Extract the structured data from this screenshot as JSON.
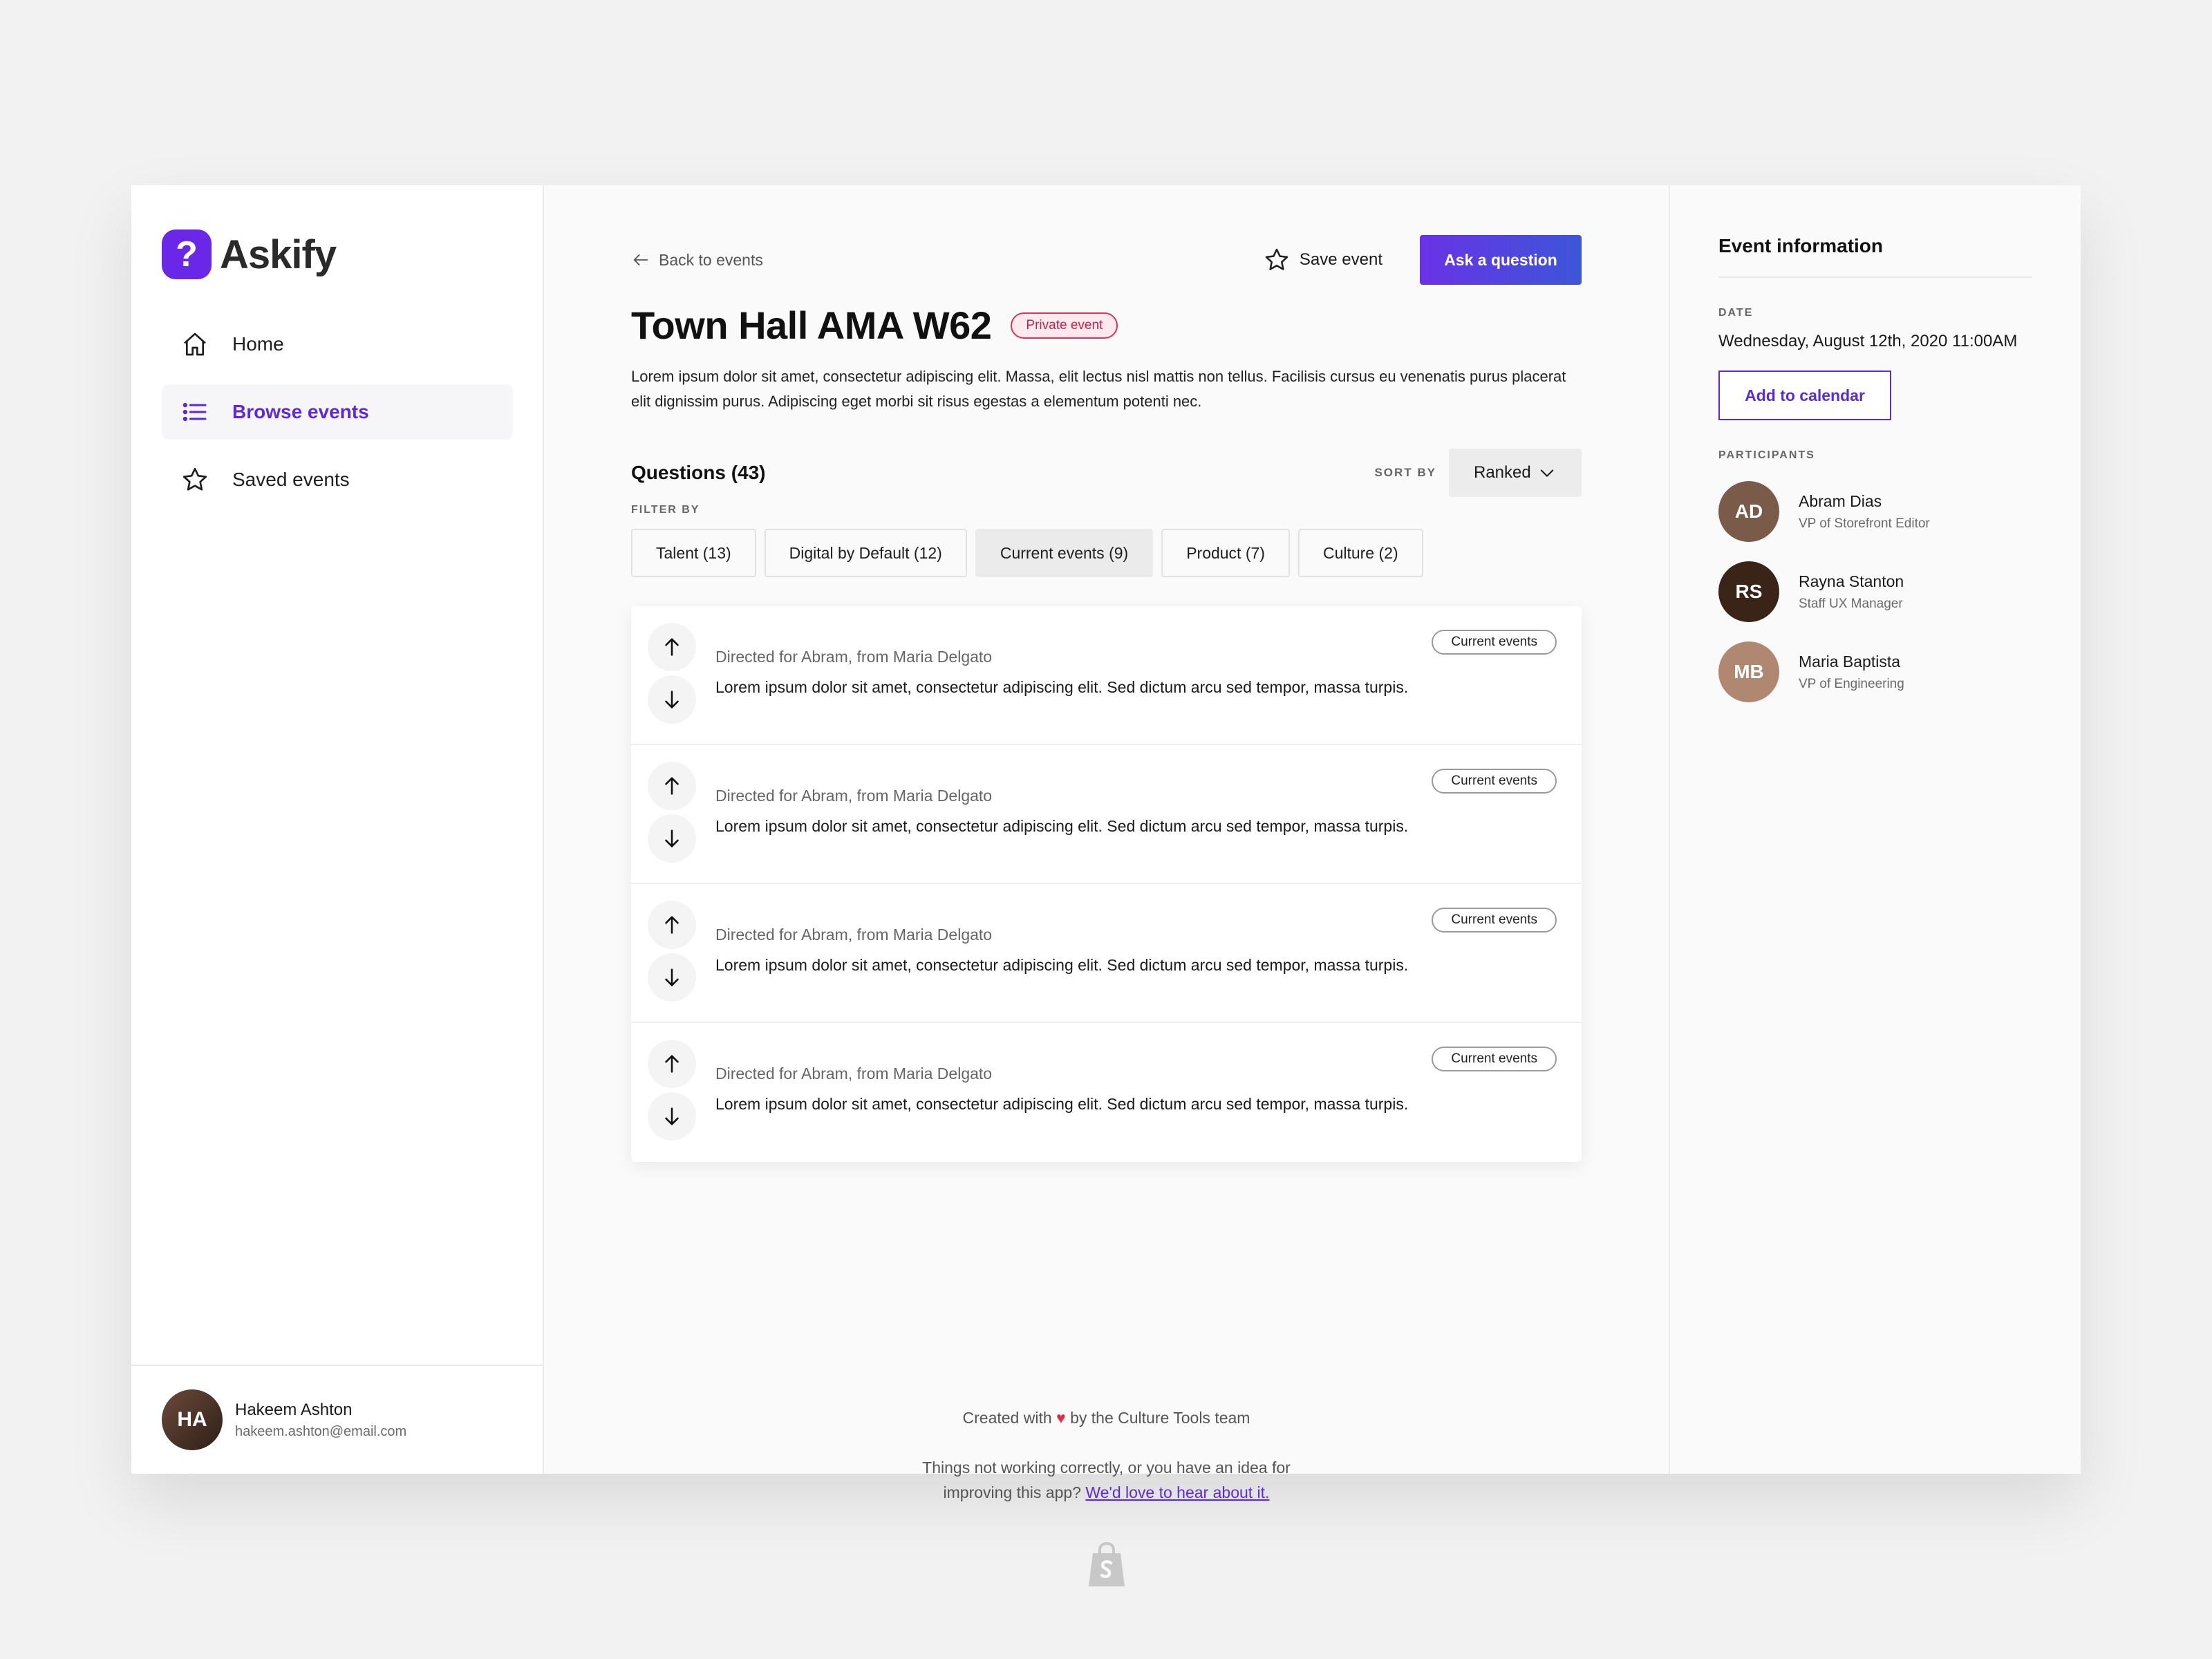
{
  "brand": {
    "name": "Askify",
    "logo_glyph": "?",
    "accent": "#6a27e8"
  },
  "nav": {
    "items": [
      {
        "label": "Home",
        "icon": "home-icon"
      },
      {
        "label": "Browse events",
        "icon": "list-icon",
        "active": true
      },
      {
        "label": "Saved events",
        "icon": "star-icon"
      }
    ]
  },
  "user": {
    "name": "Hakeem Ashton",
    "email": "hakeem.ashton@email.com",
    "initials": "HA"
  },
  "topbar": {
    "back_label": "Back to events",
    "save_label": "Save event",
    "ask_label": "Ask a question"
  },
  "event": {
    "title": "Town Hall AMA W62",
    "badge": "Private event",
    "description": "Lorem ipsum dolor sit amet, consectetur adipiscing elit. Massa, elit lectus nisl mattis non tellus. Facilisis cursus eu venenatis purus placerat elit dignissim purus. Adipiscing eget morbi sit risus egestas a elementum potenti nec."
  },
  "questions": {
    "heading": "Questions (43)",
    "sort_label": "SORT BY",
    "sort_value": "Ranked",
    "filter_label": "FILTER BY",
    "filters": [
      {
        "label": "Talent (13)"
      },
      {
        "label": "Digital by Default (12)"
      },
      {
        "label": "Current events (9)",
        "selected": true
      },
      {
        "label": "Product (7)"
      },
      {
        "label": "Culture (2)"
      }
    ],
    "items": [
      {
        "meta": "Directed for Abram, from Maria Delgato",
        "text": "Lorem ipsum dolor sit amet, consectetur adipiscing elit. Sed dictum arcu sed tempor, massa turpis.",
        "tag": "Current events"
      },
      {
        "meta": "Directed for Abram, from Maria Delgato",
        "text": "Lorem ipsum dolor sit amet, consectetur adipiscing elit. Sed dictum arcu sed tempor, massa turpis.",
        "tag": "Current events"
      },
      {
        "meta": "Directed for Abram, from Maria Delgato",
        "text": "Lorem ipsum dolor sit amet, consectetur adipiscing elit. Sed dictum arcu sed tempor, massa turpis.",
        "tag": "Current events"
      },
      {
        "meta": "Directed for Abram, from Maria Delgato",
        "text": "Lorem ipsum dolor sit amet, consectetur adipiscing elit. Sed dictum arcu sed tempor, massa turpis.",
        "tag": "Current events"
      }
    ]
  },
  "footer": {
    "created_prefix": "Created with",
    "created_suffix": "by the Culture Tools team",
    "feedback_line1": "Things not working correctly, or you have an idea for",
    "feedback_line2": "improving this app?",
    "feedback_link": "We'd love to hear about it."
  },
  "info": {
    "title": "Event information",
    "date_label": "DATE",
    "date": "Wednesday, August 12th, 2020 11:00AM",
    "calendar_label": "Add to calendar",
    "participants_label": "PARTICIPANTS",
    "participants": [
      {
        "name": "Abram Dias",
        "role": "VP of Storefront Editor",
        "initials": "AD",
        "color": "#7a5a48"
      },
      {
        "name": "Rayna Stanton",
        "role": "Staff UX Manager",
        "initials": "RS",
        "color": "#3a2418"
      },
      {
        "name": "Maria Baptista",
        "role": "VP of Engineering",
        "initials": "MB",
        "color": "#b08872"
      }
    ]
  }
}
